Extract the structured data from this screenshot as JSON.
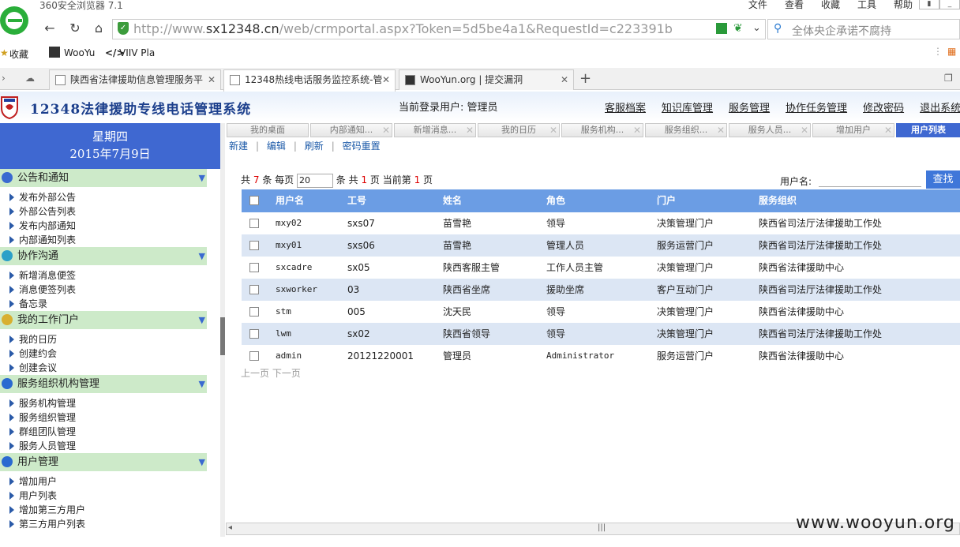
{
  "browser": {
    "title": "360安全浏览器 7.1",
    "menus": [
      "文件",
      "查看",
      "收藏",
      "工具",
      "帮助"
    ],
    "url_host": "http://www.sx12348.cn",
    "url_host_bold": "sx12348.cn",
    "url_path": "/web/crmportal.aspx?Token=5d5be4a1&RequestId=c223391b",
    "search_placeholder": "全体央企承诺不腐持",
    "bookmarks": [
      "收藏",
      "WooYu",
      "VIIV Pla"
    ],
    "tabs": [
      {
        "label": "陕西省法律援助信息管理服务平",
        "active": false
      },
      {
        "label": "12348热线电话服务监控系统-管",
        "active": true
      },
      {
        "label": "WooYun.org | 提交漏洞",
        "active": false
      }
    ]
  },
  "app": {
    "title": "12348法律援助专线电话管理系统",
    "current_user_label": "当前登录用户: 管理员",
    "topnav": [
      "客服档案",
      "知识库管理",
      "服务管理",
      "协作任务管理",
      "修改密码",
      "退出系统"
    ]
  },
  "left": {
    "weekday": "星期四",
    "date": "2015年7月9日",
    "sections": [
      {
        "title": "公告和通知",
        "color": "#3a6ad0",
        "items": [
          "发布外部公告",
          "外部公告列表",
          "发布内部通知",
          "内部通知列表"
        ]
      },
      {
        "title": "协作沟通",
        "color": "#2aa0c8",
        "items": [
          "新增消息便签",
          "消息便签列表",
          "备忘录"
        ]
      },
      {
        "title": "我的工作门户",
        "color": "#d8b030",
        "items": [
          "我的日历",
          "创建约会",
          "创建会议"
        ]
      },
      {
        "title": "服务组织机构管理",
        "color": "#2a6ad0",
        "items": [
          "服务机构管理",
          "服务组织管理",
          "群组团队管理",
          "服务人员管理"
        ]
      },
      {
        "title": "用户管理",
        "color": "#2a6ad0",
        "items": [
          "增加用户",
          "用户列表",
          "增加第三方用户",
          "第三方用户列表"
        ]
      }
    ]
  },
  "inner_tabs": [
    "我的桌面",
    "内部通知...",
    "新增消息...",
    "我的日历",
    "服务机构...",
    "服务组织...",
    "服务人员...",
    "增加用户",
    "用户列表"
  ],
  "toolbar": [
    "新建",
    "编辑",
    "刷新",
    "密码重置"
  ],
  "pager": {
    "p1": "共",
    "total": "7",
    "p2": "条 每页",
    "per_page": "20",
    "p3": "条 共",
    "pages": "1",
    "p4": "页 当前第",
    "current": "1",
    "p5": "页"
  },
  "search": {
    "label": "用户名:",
    "button": "查找"
  },
  "table": {
    "headers": [
      "用户名",
      "工号",
      "姓名",
      "角色",
      "门户",
      "服务组织"
    ],
    "rows": [
      [
        "mxy02",
        "sxs07",
        "苗雪艳",
        "领导",
        "决策管理门户",
        "陕西省司法厅法律援助工作处"
      ],
      [
        "mxy01",
        "sxs06",
        "苗雪艳",
        "管理人员",
        "服务运营门户",
        "陕西省司法厅法律援助工作处"
      ],
      [
        "sxcadre",
        "sx05",
        "陕西客服主管",
        "工作人员主管",
        "决策管理门户",
        "陕西省法律援助中心"
      ],
      [
        "sxworker",
        "03",
        "陕西省坐席",
        "援助坐席",
        "客户互动门户",
        "陕西省司法厅法律援助工作处"
      ],
      [
        "stm",
        "005",
        "沈天民",
        "领导",
        "决策管理门户",
        "陕西省法律援助中心"
      ],
      [
        "lwm",
        "sx02",
        "陕西省领导",
        "领导",
        "决策管理门户",
        "陕西省司法厅法律援助工作处"
      ],
      [
        "admin",
        "20121220001",
        "管理员",
        "Administrator",
        "服务运营门户",
        "陕西省法律援助中心"
      ]
    ]
  },
  "prevnext": "上一页 下一页",
  "watermark": "www.wooyun.org"
}
